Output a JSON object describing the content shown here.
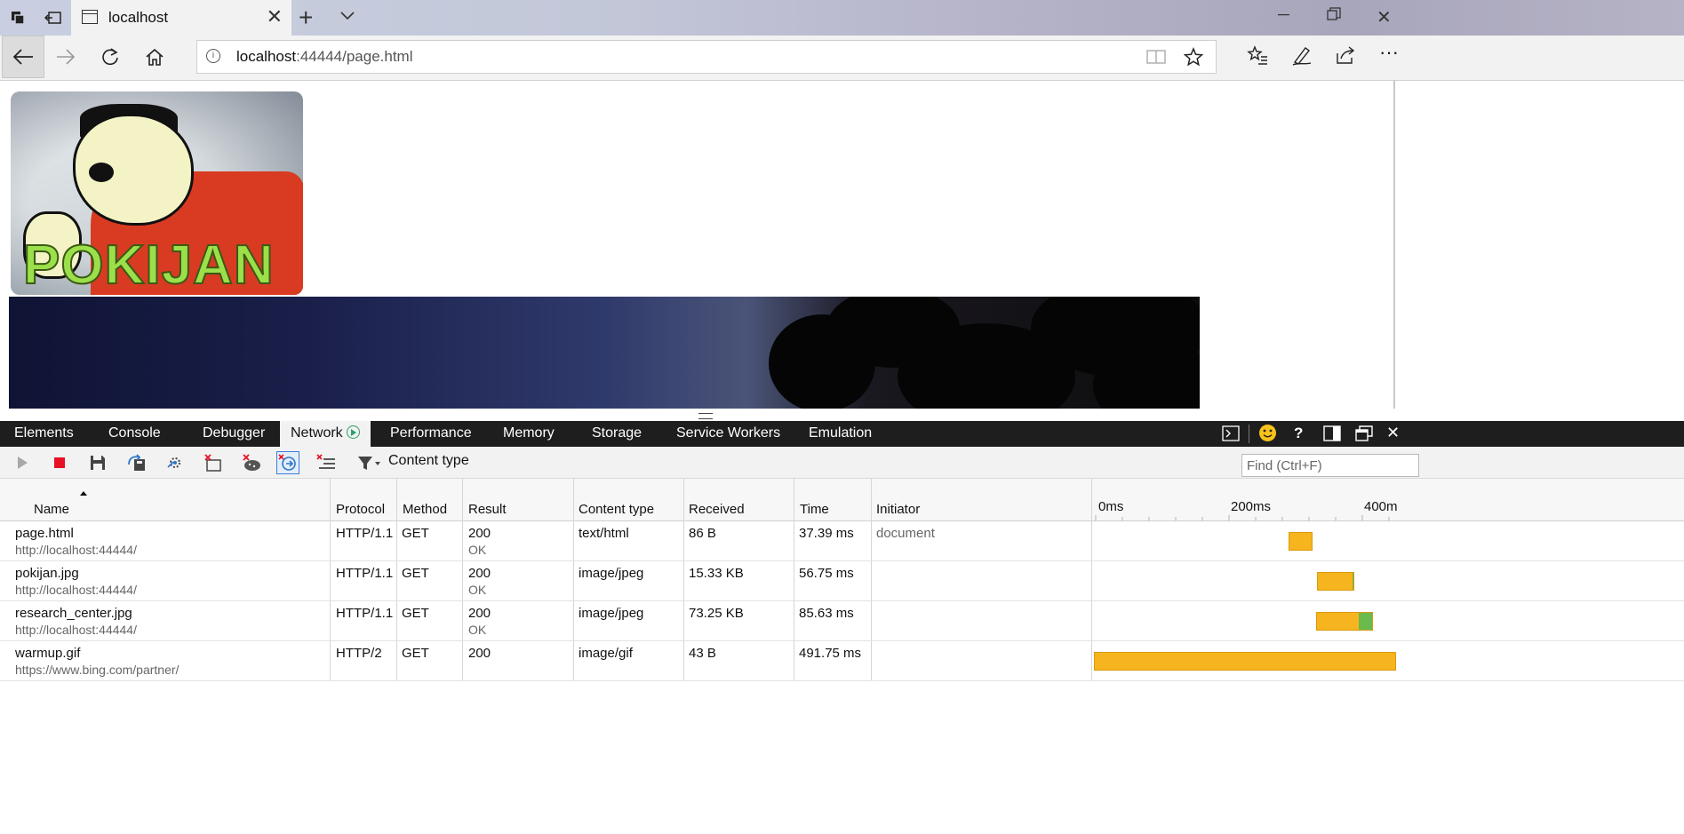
{
  "browser": {
    "tab_title": "localhost",
    "url_host": "localhost",
    "url_rest": ":44444/page.html"
  },
  "page": {
    "logo_text": "POKIJAN"
  },
  "devtools": {
    "tabs": [
      "Elements",
      "Console",
      "Debugger",
      "Network",
      "Performance",
      "Memory",
      "Storage",
      "Service Workers",
      "Emulation"
    ],
    "active_tab": "Network",
    "filter_label": "Content type",
    "find_placeholder": "Find (Ctrl+F)",
    "columns": {
      "name": "Name",
      "protocol": "Protocol",
      "method": "Method",
      "result": "Result",
      "content_type": "Content type",
      "received": "Received",
      "time": "Time",
      "initiator": "Initiator"
    },
    "timeline_labels": [
      "0ms",
      "200ms",
      "400m"
    ],
    "requests": [
      {
        "name": "page.html",
        "domain": "http://localhost:44444/",
        "protocol": "HTTP/1.1",
        "method": "GET",
        "status": "200",
        "status_text": "OK",
        "content_type": "text/html",
        "received": "86 B",
        "time": "37.39 ms",
        "initiator": "document"
      },
      {
        "name": "pokijan.jpg",
        "domain": "http://localhost:44444/",
        "protocol": "HTTP/1.1",
        "method": "GET",
        "status": "200",
        "status_text": "OK",
        "content_type": "image/jpeg",
        "received": "15.33 KB",
        "time": "56.75 ms",
        "initiator": ""
      },
      {
        "name": "research_center.jpg",
        "domain": "http://localhost:44444/",
        "protocol": "HTTP/1.1",
        "method": "GET",
        "status": "200",
        "status_text": "OK",
        "content_type": "image/jpeg",
        "received": "73.25 KB",
        "time": "85.63 ms",
        "initiator": ""
      },
      {
        "name": "warmup.gif",
        "domain": "https://www.bing.com/partner/",
        "protocol": "HTTP/2",
        "method": "GET",
        "status": "200",
        "status_text": "",
        "content_type": "image/gif",
        "received": "43 B",
        "time": "491.75 ms",
        "initiator": ""
      }
    ]
  },
  "colors": {
    "wait_bar": "#f6b51e",
    "download_bar": "#6aba4c",
    "record_stop": "#e81123",
    "devtools_tabbar": "#1e1e1e"
  }
}
